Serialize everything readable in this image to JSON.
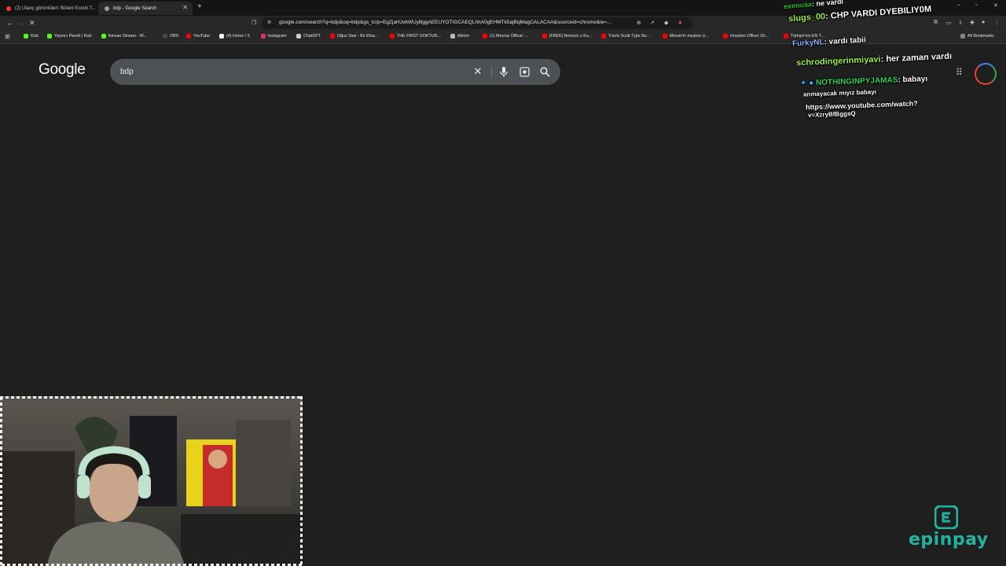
{
  "browser": {
    "tabs": [
      {
        "title": "(2) Utanç görüntüleri: Bülent Ecevit T...",
        "active": false,
        "favicon_color": "#ff3333"
      },
      {
        "title": "bdp - Google Search",
        "active": true,
        "favicon_color": "#9aa0a6"
      }
    ],
    "address": "google.com/search?q=bdp&oq=bdp&gs_lcrp=EgZjaHJvbWUyBggAEEUYOTIGCAEQLhhA0gEHMTk5ajBqMagCALACAA&sourceid=chrome&ie=...",
    "bookmarks": [
      {
        "label": "Kick",
        "color": "#53fc18"
      },
      {
        "label": "Yayıncı Paneli | Kick",
        "color": "#53fc18"
      },
      {
        "label": "ikinsan Stream - W...",
        "color": "#53fc18"
      },
      {
        "label": "OBS",
        "color": "#444444"
      },
      {
        "label": "YouTube",
        "color": "#ff0000"
      },
      {
        "label": "(4) Home / X",
        "color": "#ffffff"
      },
      {
        "label": "Instagram",
        "color": "#e1306c"
      },
      {
        "label": "ChatGPT",
        "color": "#cccccc"
      },
      {
        "label": "Oğuz Sasi - Bir Efsa...",
        "color": "#ff0000"
      },
      {
        "label": "THE FIRST GOKTUR...",
        "color": "#ff0000"
      },
      {
        "label": "Albüm",
        "color": "#bbbbbb"
      },
      {
        "label": "(1) Mezraz Offical -...",
        "color": "#ff0000"
      },
      {
        "label": "[FREE] Nemzzz x Ko...",
        "color": "#ff0000"
      },
      {
        "label": "Travis Scott Type Be...",
        "color": "#ff0000"
      },
      {
        "label": "Mersin'in meşhur ci...",
        "color": "#ff0000"
      },
      {
        "label": "Houston Officer Sh...",
        "color": "#ff0000"
      },
      {
        "label": "Türkiye'nin EN T...",
        "color": "#ff0000"
      }
    ],
    "all_bookmarks": "All Bookmarks"
  },
  "google": {
    "logo": "Google",
    "query": "bdp"
  },
  "chat": [
    {
      "user": "exenusa",
      "msg": "ne vardı"
    },
    {
      "user": "slugs_00",
      "msg": "CHP VARDI DYEBILIY0M"
    },
    {
      "user": "FurkyNL",
      "msg": "vardı tabii"
    },
    {
      "user": "schrodingerinmiyavi",
      "msg": "her zaman vardı"
    },
    {
      "user": "NOTHINGINPYJAMAS",
      "msg": "babayı"
    },
    {
      "line": "anmayacak mıyız babayı"
    },
    {
      "line": "https://www.youtube.com/watch?"
    },
    {
      "line": "v=XzryBfBggsQ"
    }
  ],
  "sponsor": "epinpay"
}
